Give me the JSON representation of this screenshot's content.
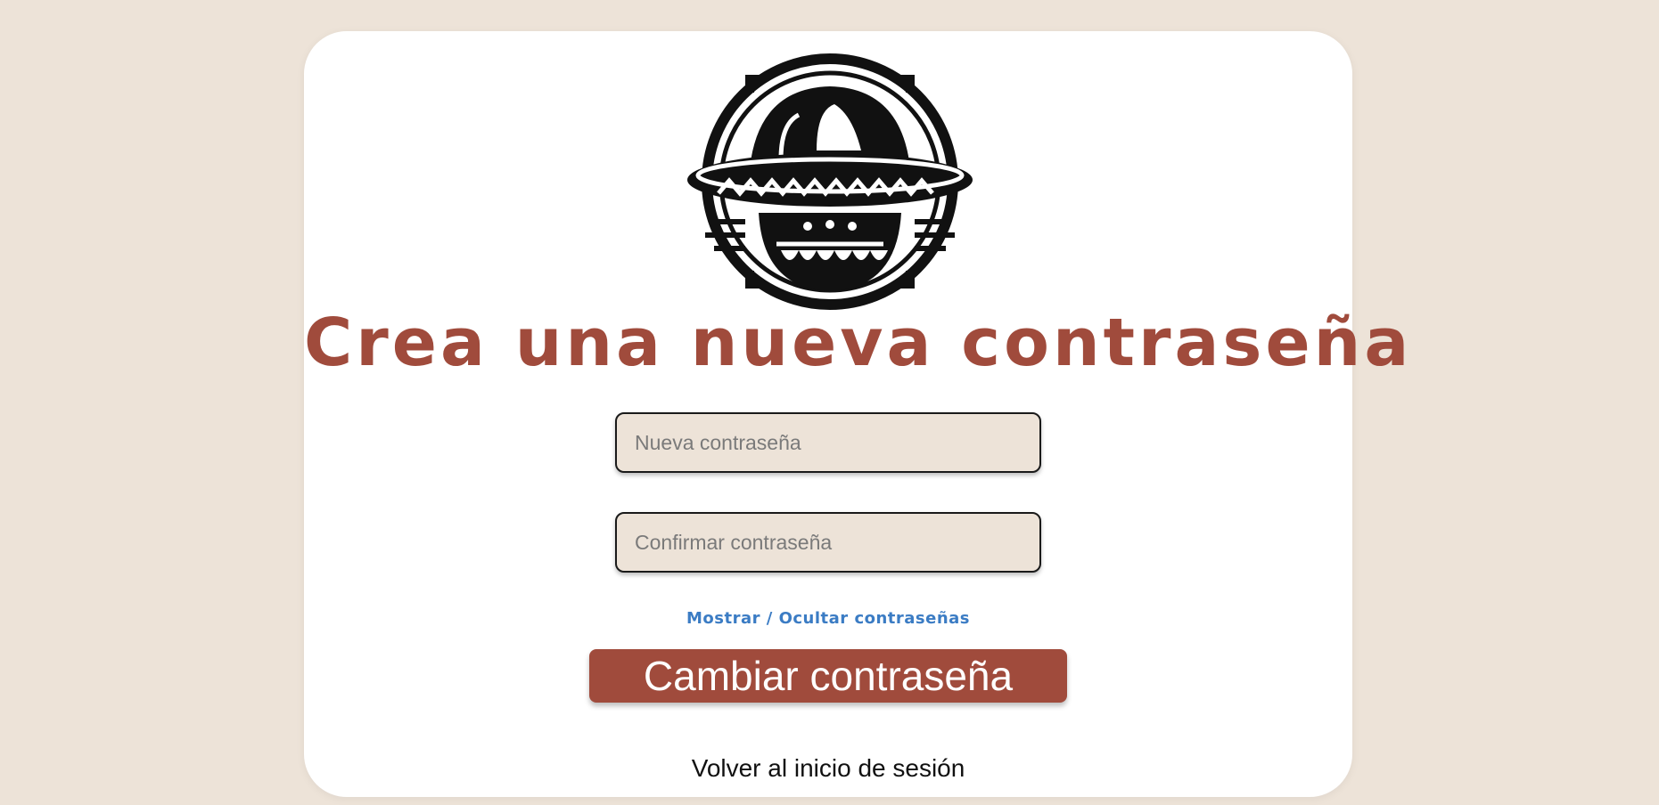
{
  "page": {
    "title": "Crea una nueva contraseña",
    "logo_icon": "sombrero-skull-logo"
  },
  "form": {
    "new_password": {
      "placeholder": "Nueva contraseña",
      "value": ""
    },
    "confirm_password": {
      "placeholder": "Confirmar contraseña",
      "value": ""
    },
    "toggle_label": "Mostrar / Ocultar contraseñas",
    "submit_label": "Cambiar contraseña",
    "back_label": "Volver al inicio de sesión"
  },
  "colors": {
    "background": "#ede3d8",
    "accent": "#a04b3c",
    "link": "#3b7cc4"
  }
}
